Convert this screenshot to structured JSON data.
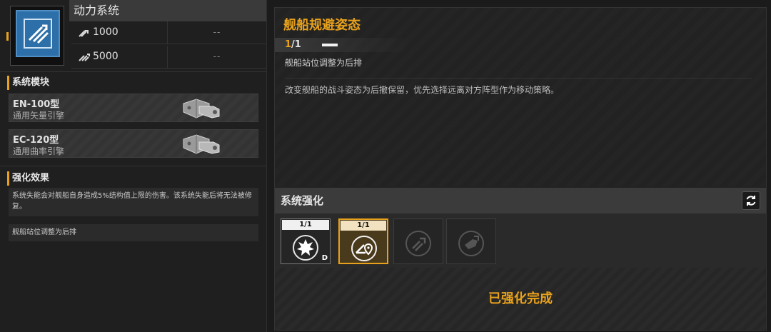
{
  "system": {
    "title": "动力系统",
    "stats": [
      {
        "value": "1000",
        "secondary": "--"
      },
      {
        "value": "5000",
        "secondary": "--"
      }
    ]
  },
  "modules": {
    "heading": "系统模块",
    "items": [
      {
        "name": "EN-100型",
        "type": "通用矢量引擎"
      },
      {
        "name": "EC-120型",
        "type": "通用曲率引擎"
      }
    ]
  },
  "effects": {
    "heading": "强化效果",
    "items": [
      "系统失能会对舰船自身造成5%结构值上限的伤害。该系统失能后将无法被修复。",
      "舰船站位调整为后排"
    ]
  },
  "stance": {
    "title": "舰船规避姿态",
    "level_current": "1",
    "level_max": "/1",
    "subtitle": "舰船站位调整为后排",
    "description": "改变舰船的战斗姿态为后撤保留，优先选择远离对方阵型作为移动策略。"
  },
  "enhancement": {
    "title": "系统强化",
    "slots": [
      {
        "count": "1/1",
        "icon": "burst-icon",
        "badge": "D",
        "state": "owned"
      },
      {
        "count": "1/1",
        "icon": "retreat-position-icon",
        "badge": "",
        "state": "selected"
      },
      {
        "icon": "engine-thrust-icon",
        "state": "locked"
      },
      {
        "icon": "ship-move-icon",
        "state": "locked"
      }
    ],
    "status": "已强化完成"
  },
  "colors": {
    "accent": "#e8a11b",
    "icon_blue": "#2d6fa8"
  }
}
